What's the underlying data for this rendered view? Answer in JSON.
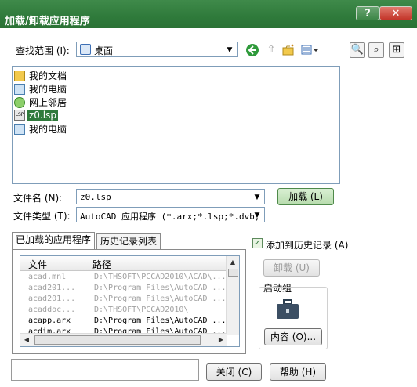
{
  "window": {
    "title": "加载/卸载应用程序",
    "help_glyph": "?",
    "close_glyph": "✕"
  },
  "lookin": {
    "label": "查找范围 (I):",
    "value": "桌面"
  },
  "files": [
    {
      "name": "我的文档",
      "icon": "folder-icon",
      "selected": false
    },
    {
      "name": "我的电脑",
      "icon": "computer-icon",
      "selected": false
    },
    {
      "name": "网上邻居",
      "icon": "network-icon",
      "selected": false
    },
    {
      "name": "z0.lsp",
      "icon": "lsp-file-icon",
      "selected": true
    },
    {
      "name": "我的电脑",
      "icon": "computer-icon",
      "selected": false
    }
  ],
  "filename": {
    "label": "文件名 (N):",
    "value": "z0.lsp"
  },
  "filetype": {
    "label": "文件类型 (T):",
    "value": "AutoCAD 应用程序 (*.arx;*.lsp;*.dvb;"
  },
  "load_button": "加载 (L)",
  "tabs": [
    "已加载的应用程序",
    "历史记录列表"
  ],
  "grid": {
    "headers": [
      "文件",
      "路径"
    ],
    "rows": [
      {
        "file": "acad.mnl",
        "path": "D:\\THSOFT\\PCCAD2010\\ACAD\\...",
        "dim": true
      },
      {
        "file": "acad201...",
        "path": "D:\\Program Files\\AutoCAD ...",
        "dim": true
      },
      {
        "file": "acad201...",
        "path": "D:\\Program Files\\AutoCAD ...",
        "dim": true
      },
      {
        "file": "acaddoc...",
        "path": "D:\\THSOFT\\PCCAD2010\\",
        "dim": true
      },
      {
        "file": "acapp.arx",
        "path": "D:\\Program Files\\AutoCAD ...",
        "dim": false
      },
      {
        "file": "acdim.arx",
        "path": "D:\\Program Files\\AutoCAD ...",
        "dim": false
      }
    ]
  },
  "add_history": {
    "label": "添加到历史记录 (A)",
    "checked": true
  },
  "unload_button": "卸载 (U)",
  "startup": {
    "label": "启动组",
    "contents_button": "内容 (O)..."
  },
  "close_button": "关闭 (C)",
  "help_button": "帮助 (H)",
  "colors": {
    "titlebar": "#2f7a3b",
    "selection": "#2f7a3b"
  }
}
